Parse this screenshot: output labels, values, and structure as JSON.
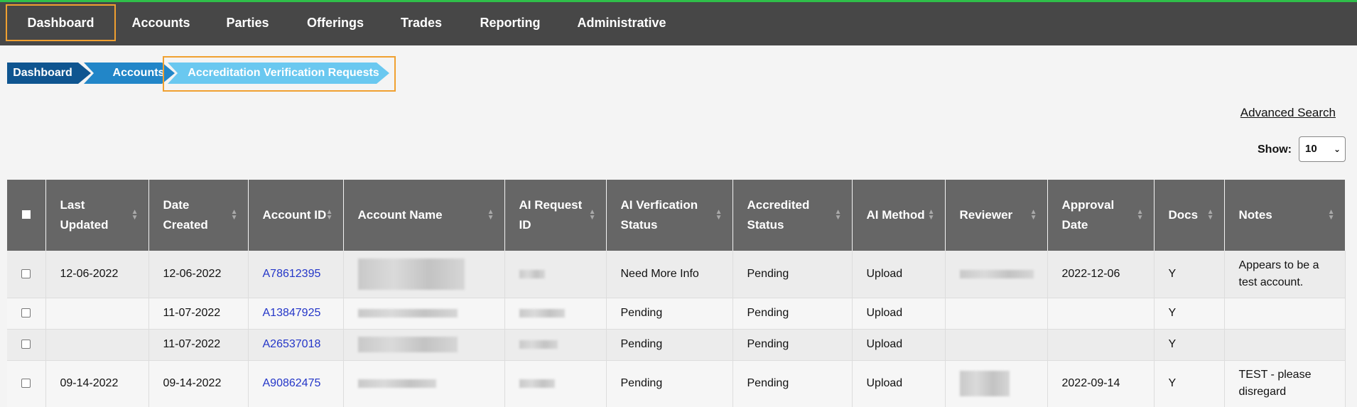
{
  "nav": {
    "items": [
      "Dashboard",
      "Accounts",
      "Parties",
      "Offerings",
      "Trades",
      "Reporting",
      "Administrative"
    ]
  },
  "breadcrumb": [
    "Dashboard",
    "Accounts",
    "Accreditation Verification Requests"
  ],
  "advanced_search": "Advanced Search",
  "show": {
    "label": "Show:",
    "value": "10"
  },
  "table": {
    "headers": [
      "Last Updated",
      "Date Created",
      "Account ID",
      "Account Name",
      "AI Request ID",
      "AI Verfication Status",
      "Accredited Status",
      "AI Method",
      "Reviewer",
      "Approval Date",
      "Docs",
      "Notes"
    ],
    "rows": [
      {
        "last_updated": "12-06-2022",
        "date_created": "12-06-2022",
        "account_id": "A78612395",
        "ai_status": "Need More Info",
        "accredited": "Pending",
        "method": "Upload",
        "approval_date": "2022-12-06",
        "docs": "Y",
        "notes": "Appears to be a test account."
      },
      {
        "last_updated": "",
        "date_created": "11-07-2022",
        "account_id": "A13847925",
        "ai_status": "Pending",
        "accredited": "Pending",
        "method": "Upload",
        "approval_date": "",
        "docs": "Y",
        "notes": ""
      },
      {
        "last_updated": "",
        "date_created": "11-07-2022",
        "account_id": "A26537018",
        "ai_status": "Pending",
        "accredited": "Pending",
        "method": "Upload",
        "approval_date": "",
        "docs": "Y",
        "notes": ""
      },
      {
        "last_updated": "09-14-2022",
        "date_created": "09-14-2022",
        "account_id": "A90862475",
        "ai_status": "Pending",
        "accredited": "Pending",
        "method": "Upload",
        "approval_date": "2022-09-14",
        "docs": "Y",
        "notes": "TEST - please disregard"
      }
    ]
  },
  "colors": {
    "nav_bg": "#474747",
    "accent_green": "#2fbf4a",
    "highlight_orange": "#f0a030",
    "header_bg": "#666666",
    "link_blue": "#2436c8"
  }
}
